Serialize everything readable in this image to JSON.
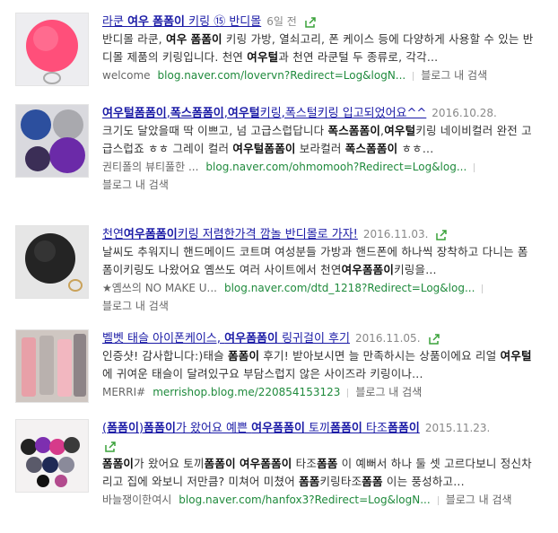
{
  "results": [
    {
      "title": "라쿤 여우 폼폼이 키링 ⑮ 반디몰",
      "date": "6일 전",
      "desc1": "반디몰 라쿤, 여우 폼폼이 키링 가방, 열쇠고리, 폰 케이스 등에 다양하게 사용할 수 있는 반",
      "desc2": "디몰 제품의 키링입니다. 천연 여우털과 천연 라쿤털 두 종류로, 각각...",
      "author": "welcome",
      "url": "blog.naver.com/lovervn?Redirect=Log&logN...",
      "blog_search": "블로그 내 검색"
    },
    {
      "title": "여우털폼폼이,폭스폼폼이,여우털키링,폭스털키링 입고되었어요^^",
      "date": "2016.10.28.",
      "desc1": "크기도 달았을때 딱 이쁘고, 넘 고급스럽답니다 폭스폼폼이,여우털키링 네이비컬러 완전 고",
      "desc2": "급스럽죠 ㅎㅎ 그레이 컬러 여우털폼폼이 보라컬러 폭스폼폼이 ㅎㅎ...",
      "author": "권티폴의 뷰티풀한 ...",
      "url": "blog.naver.com/ohmomooh?Redirect=Log&log...",
      "blog_search": "블로그 내 검색"
    },
    {
      "title": "천연여우폼폼이키링 저렴한가격 깜놀 반디몰로 가자!",
      "date": "2016.11.03.",
      "desc1": "날씨도 추워지니 핸드메이드 코트며 여성분들 가방과 핸드폰에 하나씩 장착하고 다니는 폼",
      "desc2": "폼이키링도 나왔어요 옘쓰도 여러 사이트에서 천연여우폼폼이키링을...",
      "author": "★옘쓰의 NO MAKE U...",
      "url": "blog.naver.com/dtd_1218?Redirect=Log&log...",
      "blog_search": "블로그 내 검색"
    },
    {
      "title": "벨벳 태슬 아이폰케이스, 여우폼폼이 링귀걸이 후기",
      "date": "2016.11.05.",
      "desc1": "인증샷! 감사합니다:)태슬 폼폼이 후기! 받아보시면 늘 만족하시는 상품이에요 리얼 여우털",
      "desc2": "에 귀여운 태슬이 달려있구요 부담스럽지 않은 사이즈라 키링이나...",
      "author": "MERRI#",
      "url": "merrishop.blog.me/220854153123",
      "blog_search": "블로그 내 검색"
    },
    {
      "title": "(폼폼이)폼폼이가 왔어요 예쁜 여우폼폼이 토끼폼폼이 타조폼폼이",
      "date": "2015.11.23.",
      "desc1": "폼폼이가 왔어요 토끼폼폼이 여우폼폼이 타조폼폼 이 예뻐서 하나 둘 셋 고르다보니 정신차",
      "desc2": "리고 집에 와보니 저만큼? 미쳐어 미쳤어 폼폼키링타조폼폼 이는 풍성하고...",
      "author": "바늘쟁이한여시",
      "url": "blog.naver.com/hanfox3?Redirect=Log&logN...",
      "blog_search": "블로그 내 검색"
    }
  ]
}
